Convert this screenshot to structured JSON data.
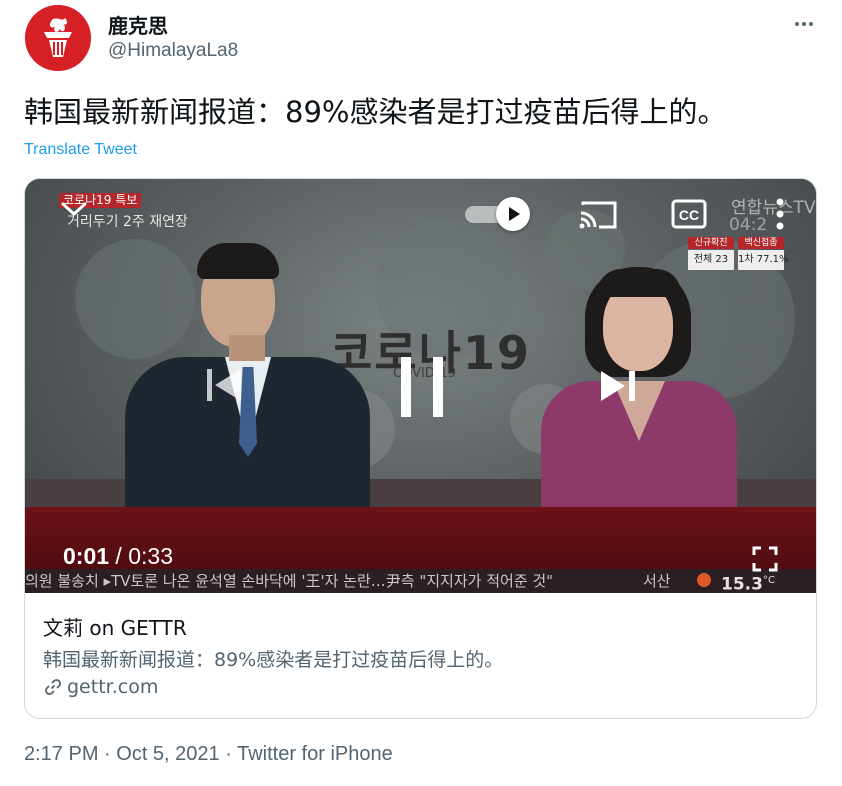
{
  "author": {
    "display_name": "鹿克思",
    "handle": "@HimalayaLa8",
    "avatar_icon": "torch-icon",
    "avatar_color": "#d71f26"
  },
  "tweet": {
    "text": "韩国最新新闻报道：89%感染者是打过疫苗后得上的。",
    "translate_label": "Translate Tweet"
  },
  "video": {
    "overlay_top_left_tag": "코로나19 특보",
    "overlay_top_left_sub": "거리두기 2주 재연장",
    "overlay_channel": "연합뉴스TV",
    "overlay_time": "04:2",
    "stat_headers": [
      "신규확진",
      "백신접종"
    ],
    "stat_values": [
      "전체 23",
      "1차 77.1%"
    ],
    "backdrop_title": "코로나19",
    "backdrop_sub": "COVID-19",
    "current_time": "0:01",
    "separator": " / ",
    "duration": "0:33",
    "ticker": "의원 불송치   ▸TV토론 나온 윤석열 손바닥에 '王'자 논란…尹측 \"지지자가 적어준 것\"",
    "ticker_location": "서산",
    "ticker_temp": "15.3",
    "ticker_unit": "°C",
    "accent_red": "#b3262a"
  },
  "card": {
    "title": "文莉 on GETTR",
    "description": "韩国最新新闻报道：89%感染者是打过疫苗后得上的。",
    "domain": "gettr.com"
  },
  "meta": {
    "time": "2:17 PM",
    "dot1": " · ",
    "date": "Oct 5, 2021",
    "dot2": " · ",
    "source": "Twitter for iPhone"
  }
}
